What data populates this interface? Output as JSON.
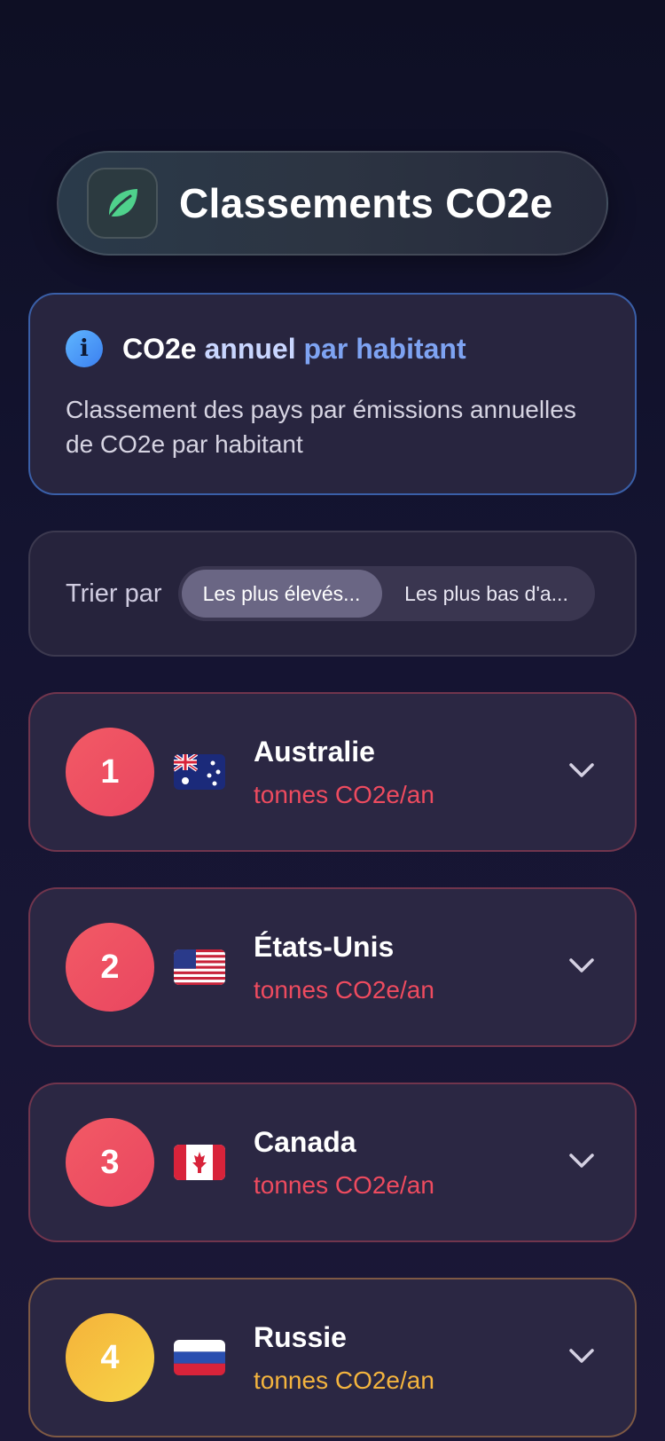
{
  "header": {
    "title": "Classements CO2e",
    "icon": "leaf-icon"
  },
  "info": {
    "icon": "info-icon",
    "icon_glyph": "i",
    "title_part1": "CO2e",
    "title_part2": " annuel ",
    "title_part3": "par habitant",
    "description": "Classement des pays par émissions annuelles de CO2e par habitant"
  },
  "sort": {
    "label": "Trier par",
    "options": [
      "Les plus élevés...",
      "Les plus bas d'a..."
    ],
    "selected": "Les plus élevés..."
  },
  "rankings": [
    {
      "rank": "1",
      "country": "Australie",
      "unit": "tonnes CO2e/an",
      "flag": "australia-flag-icon",
      "tone": "red"
    },
    {
      "rank": "2",
      "country": "États-Unis",
      "unit": "tonnes CO2e/an",
      "flag": "usa-flag-icon",
      "tone": "red"
    },
    {
      "rank": "3",
      "country": "Canada",
      "unit": "tonnes CO2e/an",
      "flag": "canada-flag-icon",
      "tone": "red"
    },
    {
      "rank": "4",
      "country": "Russie",
      "unit": "tonnes CO2e/an",
      "flag": "russia-flag-icon",
      "tone": "gold"
    }
  ],
  "colors": {
    "background": "#141431",
    "accent_red": "#ee4b5f",
    "accent_gold": "#f4b43e",
    "info_blue": "#3b7ff0"
  }
}
